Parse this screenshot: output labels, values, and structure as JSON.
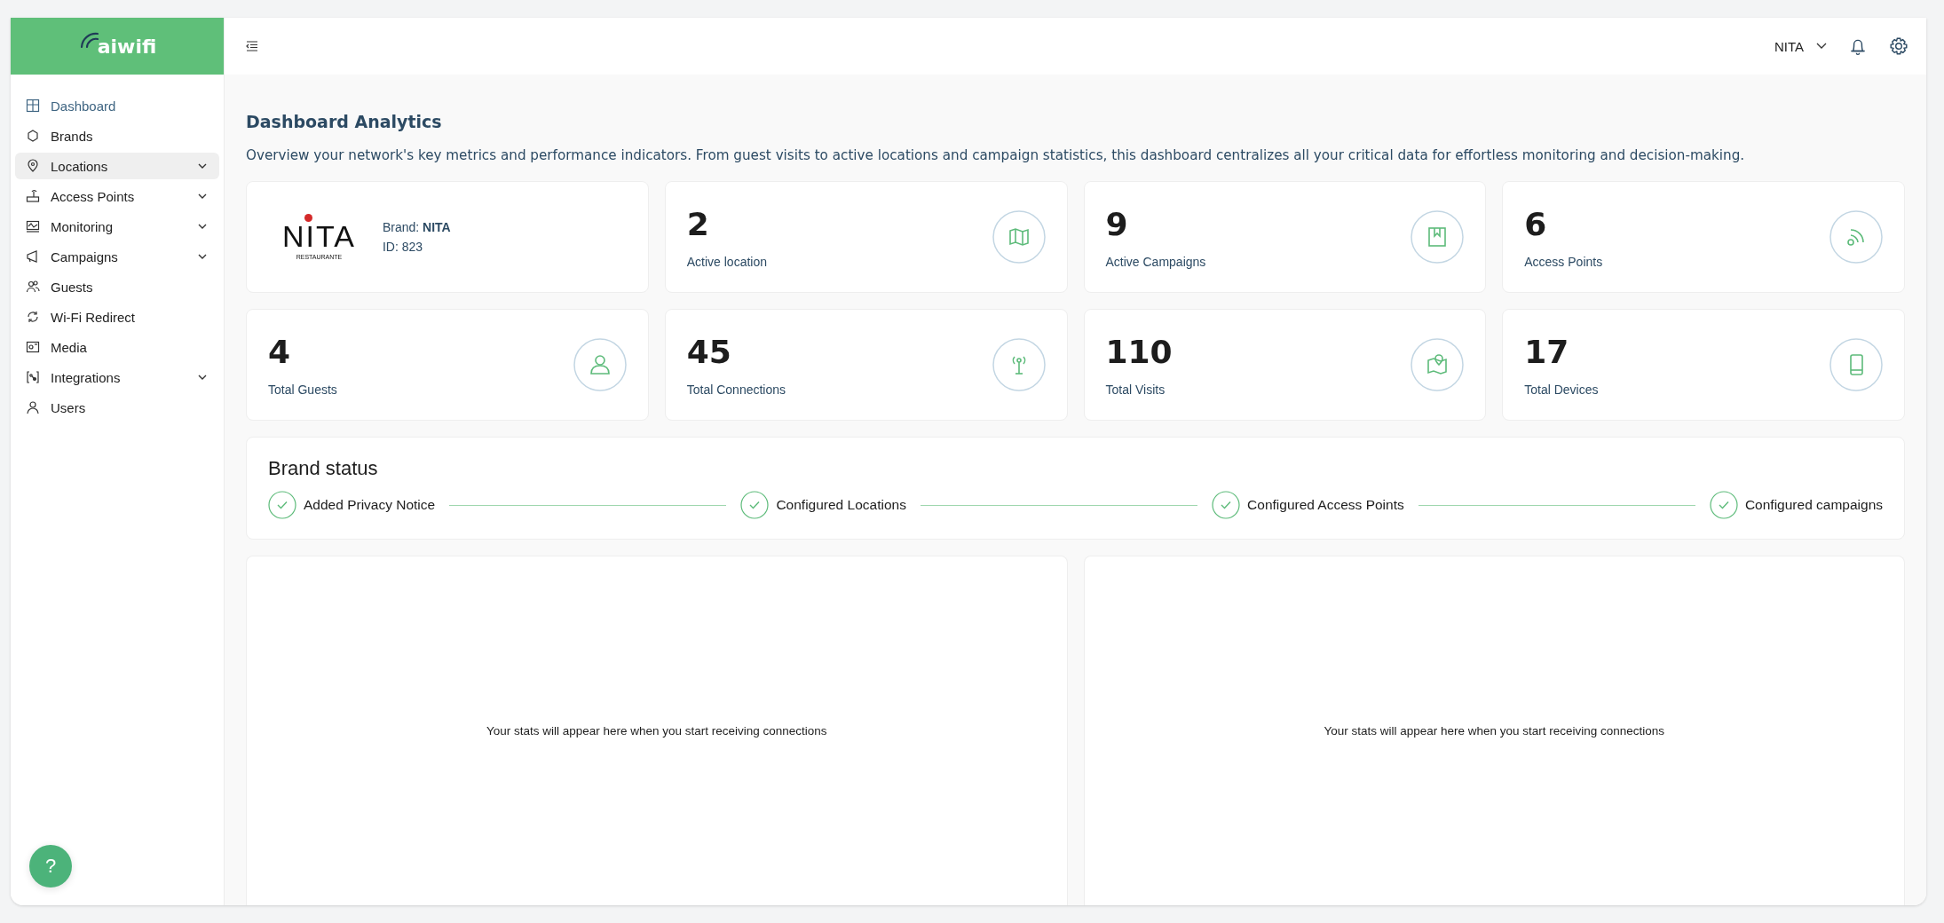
{
  "logo": {
    "text": "aiwifi"
  },
  "sidebar": {
    "items": [
      {
        "label": "Dashboard",
        "selected": true,
        "hovered": false,
        "has_submenu": false
      },
      {
        "label": "Brands",
        "selected": false,
        "hovered": false,
        "has_submenu": false
      },
      {
        "label": "Locations",
        "selected": false,
        "hovered": true,
        "has_submenu": true
      },
      {
        "label": "Access Points",
        "selected": false,
        "hovered": false,
        "has_submenu": true
      },
      {
        "label": "Monitoring",
        "selected": false,
        "hovered": false,
        "has_submenu": true
      },
      {
        "label": "Campaigns",
        "selected": false,
        "hovered": false,
        "has_submenu": true
      },
      {
        "label": "Guests",
        "selected": false,
        "hovered": false,
        "has_submenu": false
      },
      {
        "label": "Wi-Fi Redirect",
        "selected": false,
        "hovered": false,
        "has_submenu": false
      },
      {
        "label": "Media",
        "selected": false,
        "hovered": false,
        "has_submenu": false
      },
      {
        "label": "Integrations",
        "selected": false,
        "hovered": false,
        "has_submenu": true
      },
      {
        "label": "Users",
        "selected": false,
        "hovered": false,
        "has_submenu": false
      }
    ]
  },
  "help_button": {
    "label": "?"
  },
  "topbar": {
    "account": "NITA"
  },
  "page": {
    "title": "Dashboard Analytics",
    "description": "Overview your network's key metrics and performance indicators. From guest visits to active locations and campaign statistics, this dashboard centralizes all your critical data for effortless monitoring and decision-making."
  },
  "brand_card": {
    "logo_text": "NITA",
    "logo_subtitle": "RESTAURANTE",
    "brand": "Brand: **NITA**",
    "id": "ID: 823"
  },
  "stats": [
    {
      "value": "2",
      "label": "Active location"
    },
    {
      "value": "9",
      "label": "Active Campaigns"
    },
    {
      "value": "6",
      "label": "Access Points"
    },
    {
      "value": "4",
      "label": "Total Guests"
    },
    {
      "value": "45",
      "label": "Total Connections"
    },
    {
      "value": "110",
      "label": "Total Visits"
    },
    {
      "value": "17",
      "label": "Total Devices"
    }
  ],
  "brand_status": {
    "title": "Brand status",
    "steps": [
      {
        "label": "Added Privacy Notice",
        "done": true
      },
      {
        "label": "Configured Locations",
        "done": true
      },
      {
        "label": "Configured Access Points",
        "done": true
      },
      {
        "label": "Configured campaigns",
        "done": true
      }
    ]
  },
  "panels": [
    {
      "message": "Your stats will appear here when you start receiving connections"
    },
    {
      "message": "Your stats will appear here when you start receiving connections"
    }
  ]
}
